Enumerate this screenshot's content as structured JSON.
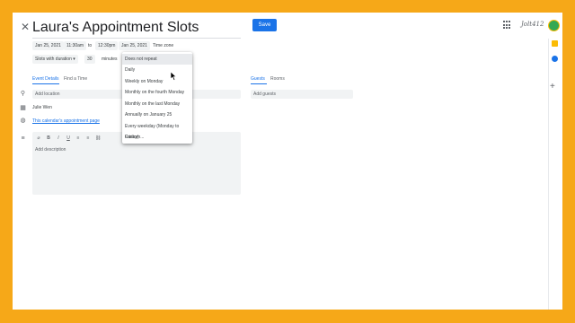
{
  "header": {
    "title": "Laura's Appointment Slots",
    "save_label": "Save",
    "brand_logo_text": "Jolt412"
  },
  "schedule": {
    "start_date": "Jan 25, 2021",
    "start_time": "11:30am",
    "to_label": "to",
    "end_time": "12:30pm",
    "end_date": "Jan 25, 2021",
    "timezone_label": "Time zone",
    "slots_mode": "Slots with duration",
    "duration_value": "30",
    "duration_unit": "minutes"
  },
  "repeat_menu": {
    "items": [
      "Does not repeat",
      "Daily",
      "Weekly on Monday",
      "Monthly on the fourth Monday",
      "Monthly on the last Monday",
      "Annually on January 25",
      "Every weekday (Monday to Friday)",
      "Custom..."
    ],
    "selected_index": 0
  },
  "tabs": {
    "left": [
      "Event Details",
      "Find a Time"
    ],
    "right": [
      "Guests",
      "Rooms"
    ]
  },
  "details": {
    "location_placeholder": "Add location",
    "organizer": "Julie Wen",
    "booking_link": "This calendar's appointment page",
    "description_placeholder": "Add description"
  },
  "guests": {
    "placeholder": "Add guests"
  },
  "toolbar": {
    "buttons": [
      "B",
      "I",
      "U",
      "≡",
      "≡",
      "⛓"
    ]
  },
  "colors": {
    "accent": "#1a73e8",
    "frame": "#f6a818"
  }
}
